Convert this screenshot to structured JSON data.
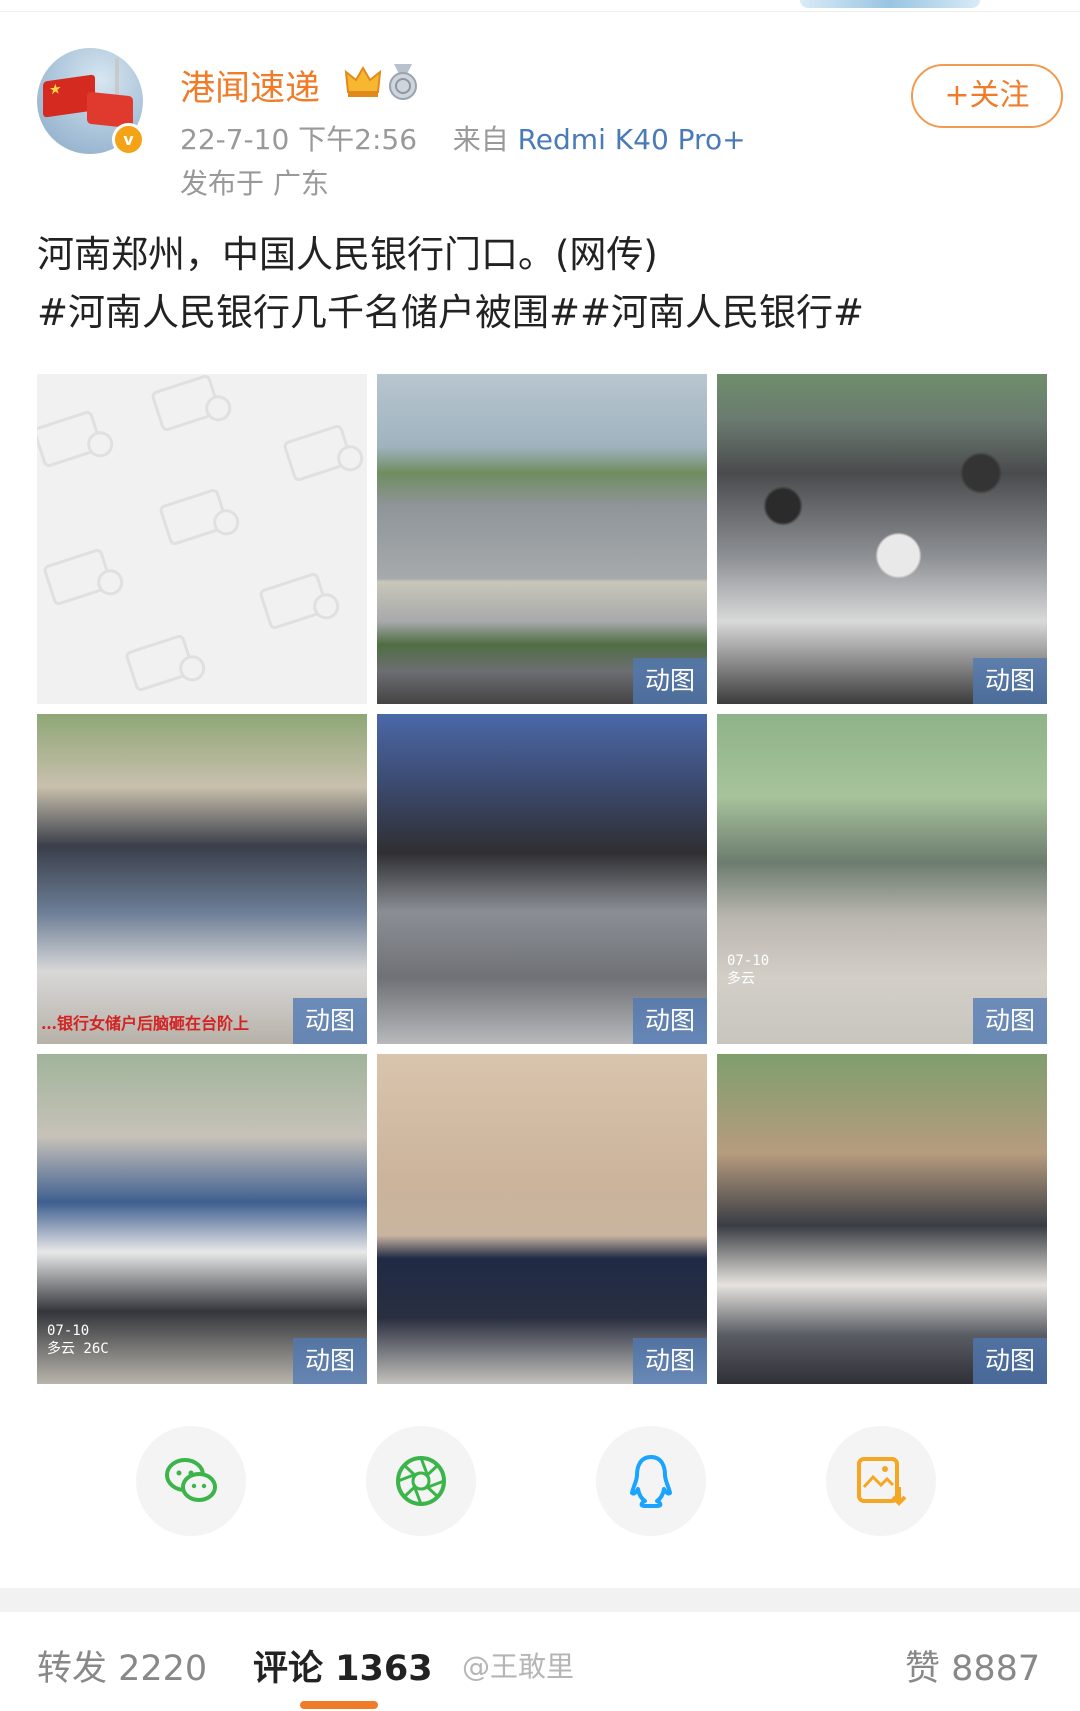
{
  "post": {
    "author": "港闻速递",
    "date": "22-7-10 下午2:56",
    "source_prefix": "来自",
    "device": "Redmi K40 Pro+",
    "location": "发布于 广东",
    "follow_label": "+关注",
    "text_line1": "河南郑州，中国人民银行门口。(网传)",
    "text_line2": "#河南人民银行几千名储户被围##河南人民银行#"
  },
  "images": [
    {
      "type": "placeholder"
    },
    {
      "type": "street",
      "badge": "动图"
    },
    {
      "type": "crowd",
      "badge": "动图"
    },
    {
      "type": "scuffle",
      "badge": "动图",
      "caption": "…银行女储户后脑砸在台阶上"
    },
    {
      "type": "scuffle",
      "badge": "动图"
    },
    {
      "type": "scuffle",
      "badge": "动图",
      "overlay": "07-10\n多云"
    },
    {
      "type": "scuffle",
      "badge": "动图",
      "overlay": "07-10\n多云 26C"
    },
    {
      "type": "fall",
      "badge": "动图"
    },
    {
      "type": "crowd",
      "badge": "动图"
    }
  ],
  "share_icons": [
    "wechat-icon",
    "moments-icon",
    "qq-icon",
    "save-image-icon"
  ],
  "colors": {
    "accent": "#f07c2a",
    "device_link": "#4a7bb7",
    "wechat": "#3bb54a",
    "qq": "#1aa3ff",
    "save": "#f5a623"
  },
  "stats": {
    "repost_label": "转发 2220",
    "comment_label": "评论 1363",
    "like_label": "赞 8887"
  },
  "watermark": "@王敢里"
}
